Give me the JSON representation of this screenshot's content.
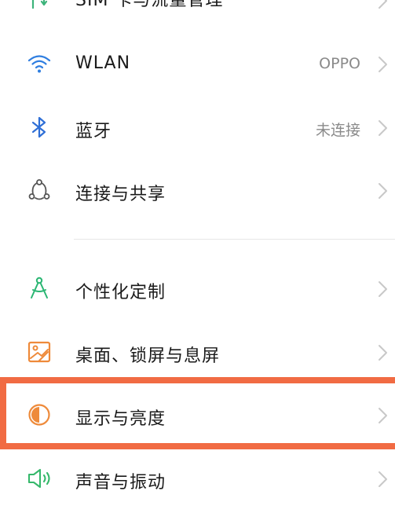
{
  "settings": {
    "items": [
      {
        "label": "SIM 卡与流量管理",
        "value": "",
        "icon": "sim-data-icon"
      },
      {
        "label": "WLAN",
        "value": "OPPO",
        "icon": "wifi-icon"
      },
      {
        "label": "蓝牙",
        "value": "未连接",
        "icon": "bluetooth-icon"
      },
      {
        "label": "连接与共享",
        "value": "",
        "icon": "connection-share-icon"
      },
      {
        "label": "个性化定制",
        "value": "",
        "icon": "personalization-icon"
      },
      {
        "label": "桌面、锁屏与息屏",
        "value": "",
        "icon": "wallpaper-icon"
      },
      {
        "label": "显示与亮度",
        "value": "",
        "icon": "display-brightness-icon"
      },
      {
        "label": "声音与振动",
        "value": "",
        "icon": "sound-vibration-icon"
      }
    ]
  },
  "colors": {
    "highlight_border": "#f16b43",
    "wifi": "#2f7ee0",
    "bluetooth": "#2f6fd6",
    "personalization": "#2bb673",
    "orange_icon": "#ee8a3a",
    "sound": "#36b86b",
    "chevron": "#c8c8c8"
  }
}
